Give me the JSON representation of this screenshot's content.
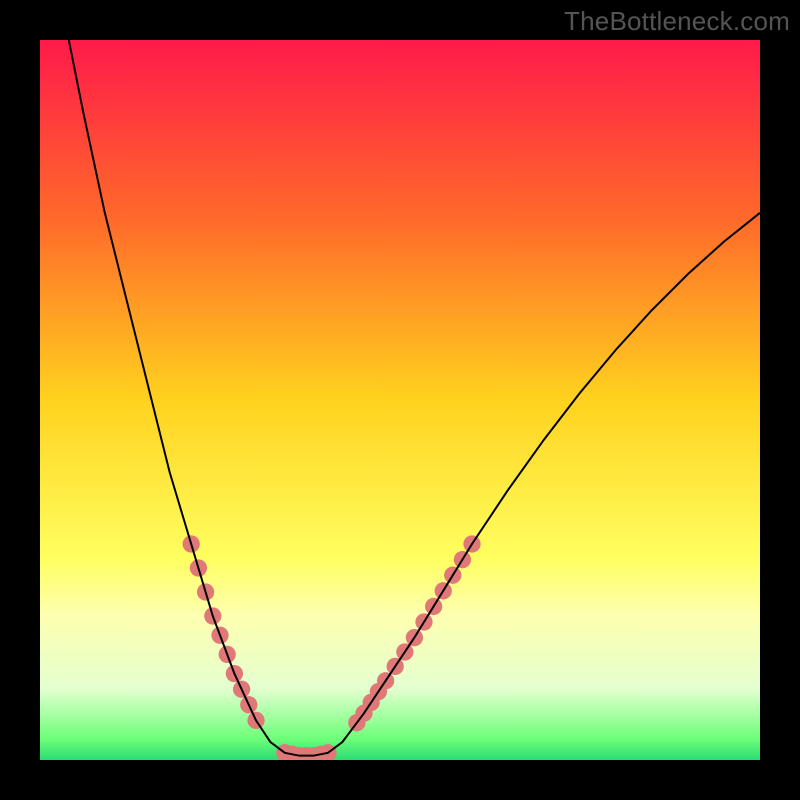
{
  "watermark": "TheBottleneck.com",
  "chart_data": {
    "type": "line",
    "title": "",
    "xlabel": "",
    "ylabel": "",
    "xlim": [
      0,
      100
    ],
    "ylim": [
      0,
      100
    ],
    "background_gradient": {
      "stops": [
        {
          "pos": 0.0,
          "color": "#ff1a4a"
        },
        {
          "pos": 0.25,
          "color": "#ff6a2a"
        },
        {
          "pos": 0.5,
          "color": "#ffd21e"
        },
        {
          "pos": 0.72,
          "color": "#ffff60"
        },
        {
          "pos": 0.8,
          "color": "#fdffb0"
        },
        {
          "pos": 0.9,
          "color": "#e4ffd0"
        },
        {
          "pos": 0.97,
          "color": "#6eff7a"
        },
        {
          "pos": 1.0,
          "color": "#2cdc74"
        }
      ]
    },
    "series": [
      {
        "name": "left-arm",
        "stroke": "#000000",
        "points": [
          {
            "x": 4.0,
            "y": 100.0
          },
          {
            "x": 6.0,
            "y": 90.0
          },
          {
            "x": 9.0,
            "y": 76.0
          },
          {
            "x": 12.0,
            "y": 64.0
          },
          {
            "x": 15.0,
            "y": 52.0
          },
          {
            "x": 18.0,
            "y": 40.0
          },
          {
            "x": 21.0,
            "y": 30.0
          },
          {
            "x": 24.0,
            "y": 20.0
          },
          {
            "x": 27.0,
            "y": 12.0
          },
          {
            "x": 30.0,
            "y": 5.5
          },
          {
            "x": 32.0,
            "y": 2.5
          },
          {
            "x": 34.0,
            "y": 1.0
          }
        ]
      },
      {
        "name": "valley-floor",
        "stroke": "#000000",
        "points": [
          {
            "x": 34.0,
            "y": 1.0
          },
          {
            "x": 36.0,
            "y": 0.6
          },
          {
            "x": 38.0,
            "y": 0.6
          },
          {
            "x": 40.0,
            "y": 1.0
          }
        ]
      },
      {
        "name": "right-arm",
        "stroke": "#000000",
        "points": [
          {
            "x": 40.0,
            "y": 1.0
          },
          {
            "x": 42.0,
            "y": 2.5
          },
          {
            "x": 45.0,
            "y": 6.5
          },
          {
            "x": 48.0,
            "y": 11.0
          },
          {
            "x": 52.0,
            "y": 17.0
          },
          {
            "x": 56.0,
            "y": 23.5
          },
          {
            "x": 60.0,
            "y": 30.0
          },
          {
            "x": 65.0,
            "y": 37.5
          },
          {
            "x": 70.0,
            "y": 44.5
          },
          {
            "x": 75.0,
            "y": 51.0
          },
          {
            "x": 80.0,
            "y": 57.0
          },
          {
            "x": 85.0,
            "y": 62.5
          },
          {
            "x": 90.0,
            "y": 67.5
          },
          {
            "x": 95.0,
            "y": 72.0
          },
          {
            "x": 100.0,
            "y": 76.0
          }
        ]
      }
    ],
    "marker_segments": {
      "color": "#e07878",
      "radius_pct": 1.2,
      "left_arm_range": {
        "y_min": 5,
        "y_max": 30
      },
      "right_arm_range": {
        "y_min": 5,
        "y_max": 30
      },
      "floor": true
    }
  }
}
